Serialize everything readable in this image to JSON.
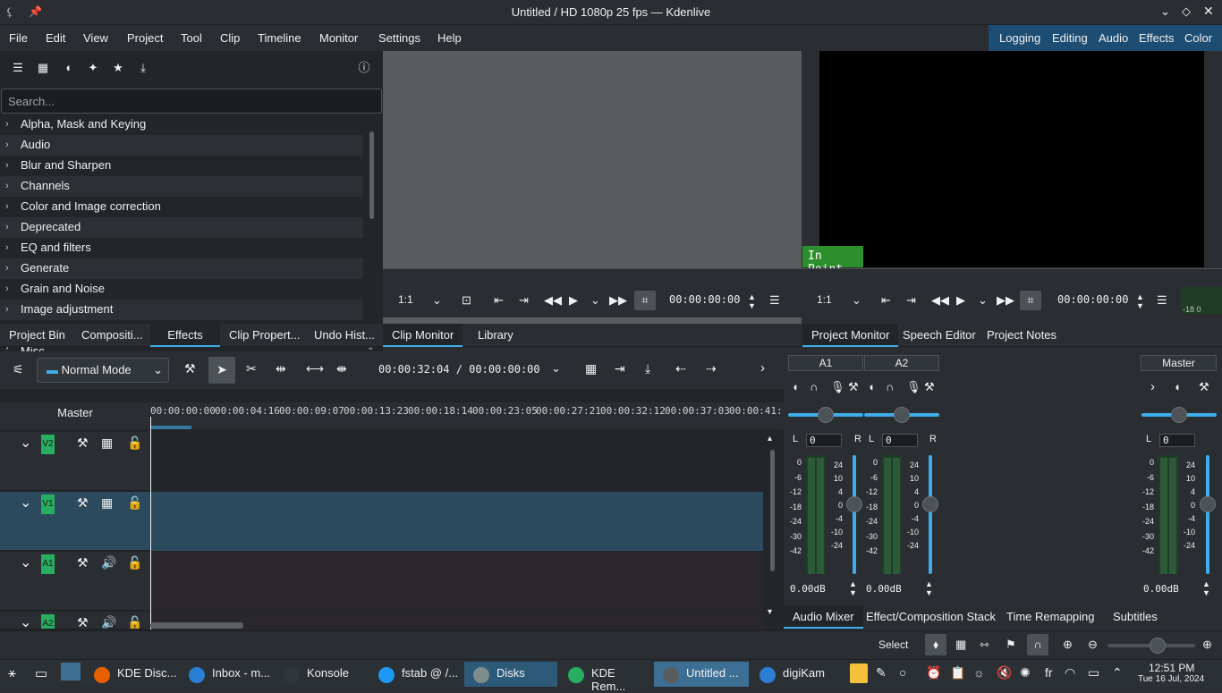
{
  "window": {
    "title": "Untitled / HD 1080p 25 fps — Kdenlive"
  },
  "menu": [
    "File",
    "Edit",
    "View",
    "Project",
    "Tool",
    "Clip",
    "Timeline",
    "Monitor",
    "Settings",
    "Help"
  ],
  "layouts": [
    "Logging",
    "Editing",
    "Audio",
    "Effects",
    "Color"
  ],
  "effects": {
    "search_placeholder": "Search...",
    "categories": [
      "Alpha, Mask and Keying",
      "Audio",
      "Blur and Sharpen",
      "Channels",
      "Color and Image correction",
      "Deprecated",
      "EQ and filters",
      "Generate",
      "Grain and Noise",
      "Image adjustment",
      "Misc"
    ]
  },
  "clip_monitor": {
    "zoom": "1:1",
    "timecode": "00:00:00:00"
  },
  "project_monitor": {
    "zoom": "1:1",
    "timecode": "00:00:00:00",
    "in_point": "In Point",
    "meter_label": "-18 0"
  },
  "tabs_left": [
    "Project Bin",
    "Compositi...",
    "Effects",
    "Clip Propert...",
    "Undo Hist..."
  ],
  "tabs_mid": [
    "Clip Monitor",
    "Library"
  ],
  "tabs_right": [
    "Project Monitor",
    "Speech Editor",
    "Project Notes"
  ],
  "timeline": {
    "mode": "Normal Mode",
    "position": "00:00:32:04 / 00:00:00:00",
    "master_label": "Master",
    "ruler": [
      "00:00:00:00",
      "00:00:04:16",
      "00:00:09:07",
      "00:00:13:23",
      "00:00:18:14",
      "00:00:23:05",
      "00:00:27:21",
      "00:00:32:12",
      "00:00:37:03",
      "00:00:41:19"
    ],
    "tracks": [
      "V2",
      "V1",
      "A1",
      "A2"
    ]
  },
  "mixer": {
    "channels": [
      {
        "name": "A1",
        "gain": "0",
        "db": "0.00dB"
      },
      {
        "name": "A2",
        "gain": "0",
        "db": "0.00dB"
      },
      {
        "name": "Master",
        "gain": "0",
        "db": "0.00dB"
      }
    ],
    "scale_left": [
      "0",
      "-6",
      "-12",
      "-18",
      "-24",
      "-30",
      "-42"
    ],
    "scale_right": [
      "24",
      "10",
      "4",
      "0",
      "-4",
      "-10",
      "-24"
    ],
    "lr": [
      "L",
      "R"
    ]
  },
  "bottom_tabs": [
    "Audio Mixer",
    "Effect/Composition Stack",
    "Time Remapping",
    "Subtitles"
  ],
  "status": {
    "select": "Select"
  },
  "taskbar": {
    "tasks": [
      {
        "label": "KDE Disc...",
        "color": "#e66000"
      },
      {
        "label": "Inbox - m...",
        "color": "#2a7fd4"
      },
      {
        "label": "Konsole",
        "color": "#31363b"
      },
      {
        "label": "fstab @ /...",
        "color": "#1d99f3"
      },
      {
        "label": "Disks",
        "color": "#7f8c8d"
      },
      {
        "label": "KDE Rem...",
        "color": "#27ae60"
      },
      {
        "label": "Untitled ...",
        "color": "#5a5d60"
      },
      {
        "label": "digiKam",
        "color": "#2a7fd4"
      }
    ],
    "clock": "12:51 PM",
    "date": "Tue 16 Jul, 2024",
    "lang": "fr"
  }
}
